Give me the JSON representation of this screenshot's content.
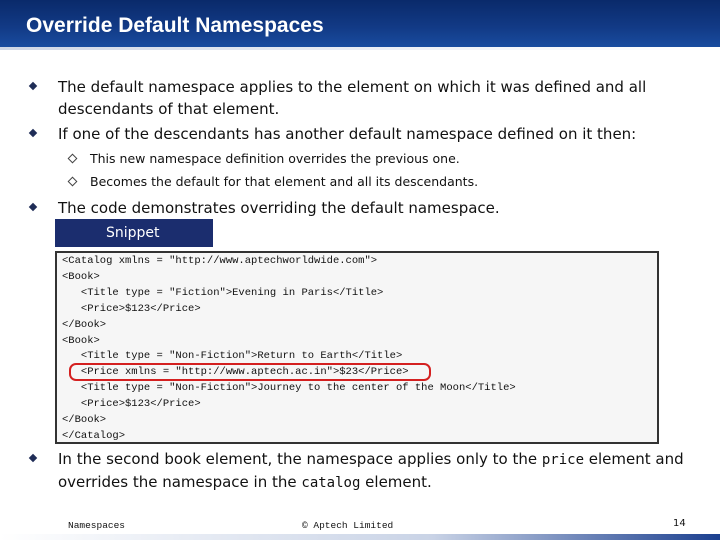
{
  "header": {
    "title": "Override Default Namespaces"
  },
  "bullets": {
    "b1_line1": "The default namespace applies to the element on which it was defined and all",
    "b1_line2": "descendants of that element.",
    "b2": "If one of the descendants has another default namespace defined on it then:",
    "b2_sub1": "This new namespace definition overrides the previous one.",
    "b2_sub2": "Becomes the default for that element and all its descendants.",
    "b3": "The code demonstrates overriding the default namespace.",
    "b4_part1": "In the second book element, the namespace applies only to the ",
    "b4_code1": "price",
    "b4_part2": " element and",
    "b4_line2_part1": "overrides the namespace in the ",
    "b4_code2": "catalog",
    "b4_line2_part2": " element."
  },
  "snippet": {
    "tab_label": "Snippet",
    "lines": [
      "<Catalog xmlns = \"http://www.aptechworldwide.com\">",
      "<Book>",
      "   <Title type = \"Fiction\">Evening in Paris</Title>",
      "   <Price>$123</Price>",
      "</Book>",
      "<Book>",
      "   <Title type = \"Non-Fiction\">Return to Earth</Title>",
      "   <Price xmlns = \"http://www.aptech.ac.in\">$23</Price>",
      "   <Title type = \"Non-Fiction\">Journey to the center of the Moon</Title>",
      "   <Price>$123</Price>",
      "</Book>",
      "</Catalog>"
    ]
  },
  "footer": {
    "left": "Namespaces",
    "center": "© Aptech Limited",
    "page_number": "14"
  },
  "colors": {
    "title_bar": "#123a86",
    "snippet_tab": "#1b2d6e",
    "highlight_border": "#d42020"
  }
}
